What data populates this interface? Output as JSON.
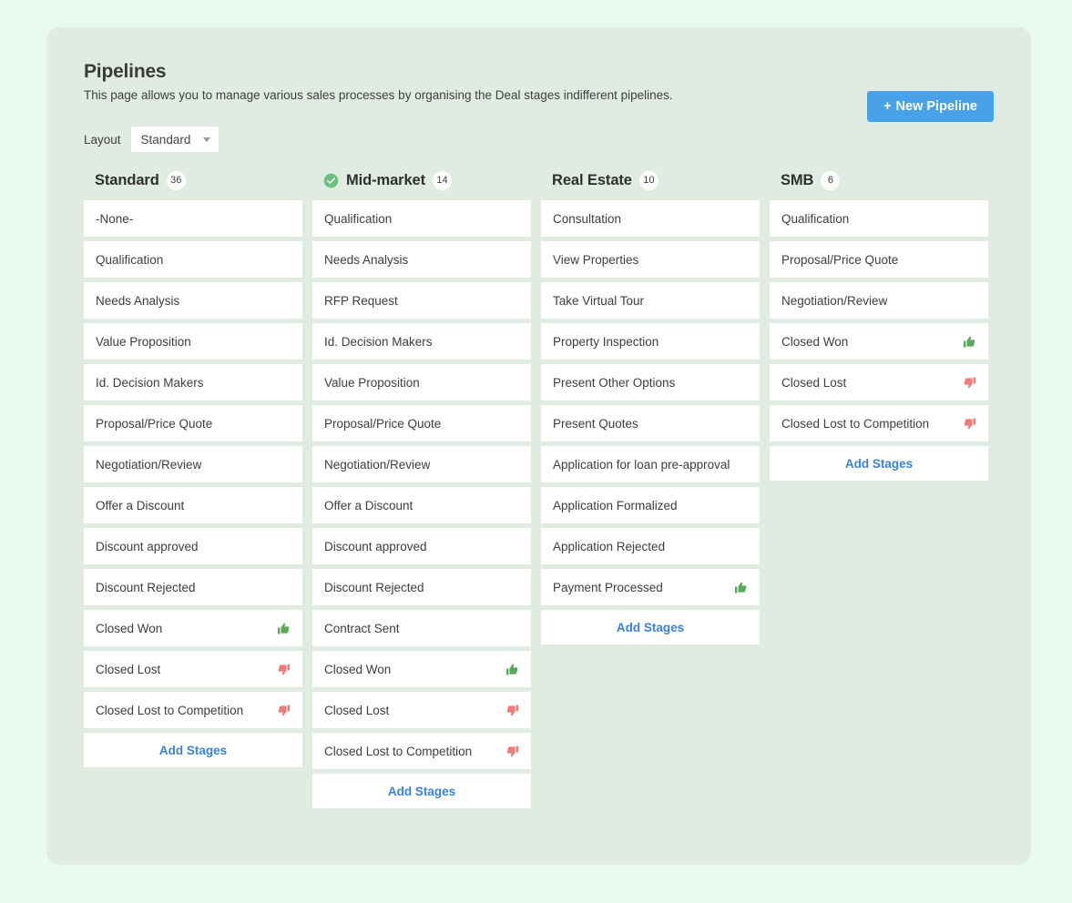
{
  "header": {
    "title": "Pipelines",
    "subtitle": "This page allows you to manage various sales processes by organising the Deal stages indifferent pipelines.",
    "new_pipeline_label": "New Pipeline",
    "new_pipeline_plus": "+"
  },
  "layout": {
    "label": "Layout",
    "value": "Standard",
    "options": [
      "Standard"
    ]
  },
  "colors": {
    "accent_blue": "#49a2e8",
    "link_blue": "#3b82d6",
    "thumbs_up_green": "#5aa85a",
    "thumbs_down_red": "#ef7b7b",
    "check_green": "#6cbf7f",
    "page_bg": "#e9fbee",
    "panel_bg": "#e0ece1",
    "card_bg": "#ffffff"
  },
  "add_stages_label": "Add Stages",
  "pipelines": [
    {
      "name": "Standard",
      "count": "36",
      "active": false,
      "stages": [
        {
          "label": "-None-",
          "icon": null
        },
        {
          "label": "Qualification",
          "icon": null
        },
        {
          "label": "Needs Analysis",
          "icon": null
        },
        {
          "label": "Value Proposition",
          "icon": null
        },
        {
          "label": "Id. Decision Makers",
          "icon": null
        },
        {
          "label": "Proposal/Price Quote",
          "icon": null
        },
        {
          "label": "Negotiation/Review",
          "icon": null
        },
        {
          "label": "Offer a Discount",
          "icon": null
        },
        {
          "label": "Discount approved",
          "icon": null
        },
        {
          "label": "Discount Rejected",
          "icon": null
        },
        {
          "label": "Closed Won",
          "icon": "thumbs-up-icon"
        },
        {
          "label": "Closed Lost",
          "icon": "thumbs-down-icon"
        },
        {
          "label": "Closed Lost to Competition",
          "icon": "thumbs-down-icon"
        }
      ]
    },
    {
      "name": "Mid-market",
      "count": "14",
      "active": true,
      "stages": [
        {
          "label": "Qualification",
          "icon": null
        },
        {
          "label": "Needs Analysis",
          "icon": null
        },
        {
          "label": "RFP Request",
          "icon": null
        },
        {
          "label": "Id. Decision Makers",
          "icon": null
        },
        {
          "label": "Value Proposition",
          "icon": null
        },
        {
          "label": "Proposal/Price Quote",
          "icon": null
        },
        {
          "label": "Negotiation/Review",
          "icon": null
        },
        {
          "label": "Offer a Discount",
          "icon": null
        },
        {
          "label": "Discount approved",
          "icon": null
        },
        {
          "label": "Discount Rejected",
          "icon": null
        },
        {
          "label": "Contract Sent",
          "icon": null
        },
        {
          "label": "Closed Won",
          "icon": "thumbs-up-icon"
        },
        {
          "label": "Closed Lost",
          "icon": "thumbs-down-icon"
        },
        {
          "label": "Closed Lost to Competition",
          "icon": "thumbs-down-icon"
        }
      ]
    },
    {
      "name": "Real Estate",
      "count": "10",
      "active": false,
      "stages": [
        {
          "label": "Consultation",
          "icon": null
        },
        {
          "label": "View Properties",
          "icon": null
        },
        {
          "label": "Take Virtual Tour",
          "icon": null
        },
        {
          "label": "Property Inspection",
          "icon": null
        },
        {
          "label": "Present Other Options",
          "icon": null
        },
        {
          "label": "Present Quotes",
          "icon": null
        },
        {
          "label": "Application for loan pre-approval",
          "icon": null
        },
        {
          "label": "Application Formalized",
          "icon": null
        },
        {
          "label": "Application Rejected",
          "icon": null
        },
        {
          "label": "Payment Processed",
          "icon": "thumbs-up-icon"
        }
      ]
    },
    {
      "name": "SMB",
      "count": "6",
      "active": false,
      "stages": [
        {
          "label": "Qualification",
          "icon": null
        },
        {
          "label": "Proposal/Price Quote",
          "icon": null
        },
        {
          "label": "Negotiation/Review",
          "icon": null
        },
        {
          "label": "Closed Won",
          "icon": "thumbs-up-icon"
        },
        {
          "label": "Closed Lost",
          "icon": "thumbs-down-icon"
        },
        {
          "label": "Closed Lost to Competition",
          "icon": "thumbs-down-icon"
        }
      ]
    }
  ]
}
